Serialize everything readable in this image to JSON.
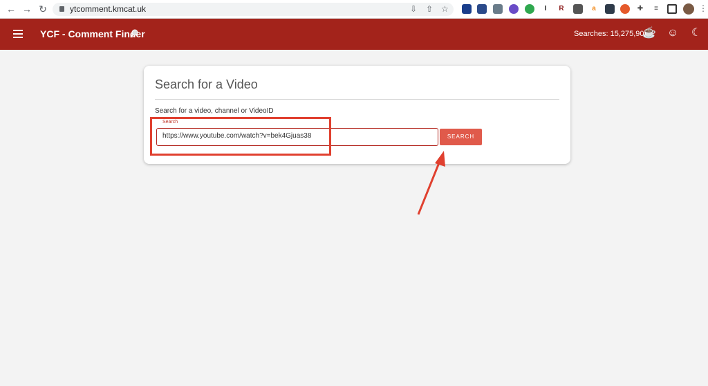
{
  "browser": {
    "url": "ytcomment.kmcat.uk",
    "icons": [
      "back-icon",
      "forward-icon",
      "reload-icon",
      "install-icon",
      "share-icon",
      "star-icon",
      "extensions-icon",
      "tab-search-icon",
      "sidepanel-icon",
      "profile-avatar"
    ]
  },
  "appbar": {
    "title": "YCF - Comment Finder",
    "searches_label": "Searches: 15,275,905",
    "background": "#a3231b"
  },
  "card": {
    "title": "Search for a Video",
    "hint": "Search for a video, channel or VideoID",
    "field_label": "Search",
    "field_value": "https://www.youtube.com/watch?v=bek4Gjuas38",
    "button_label": "SEARCH",
    "button_color": "#e05a4b"
  },
  "annotation": {
    "color": "#e0402f"
  }
}
